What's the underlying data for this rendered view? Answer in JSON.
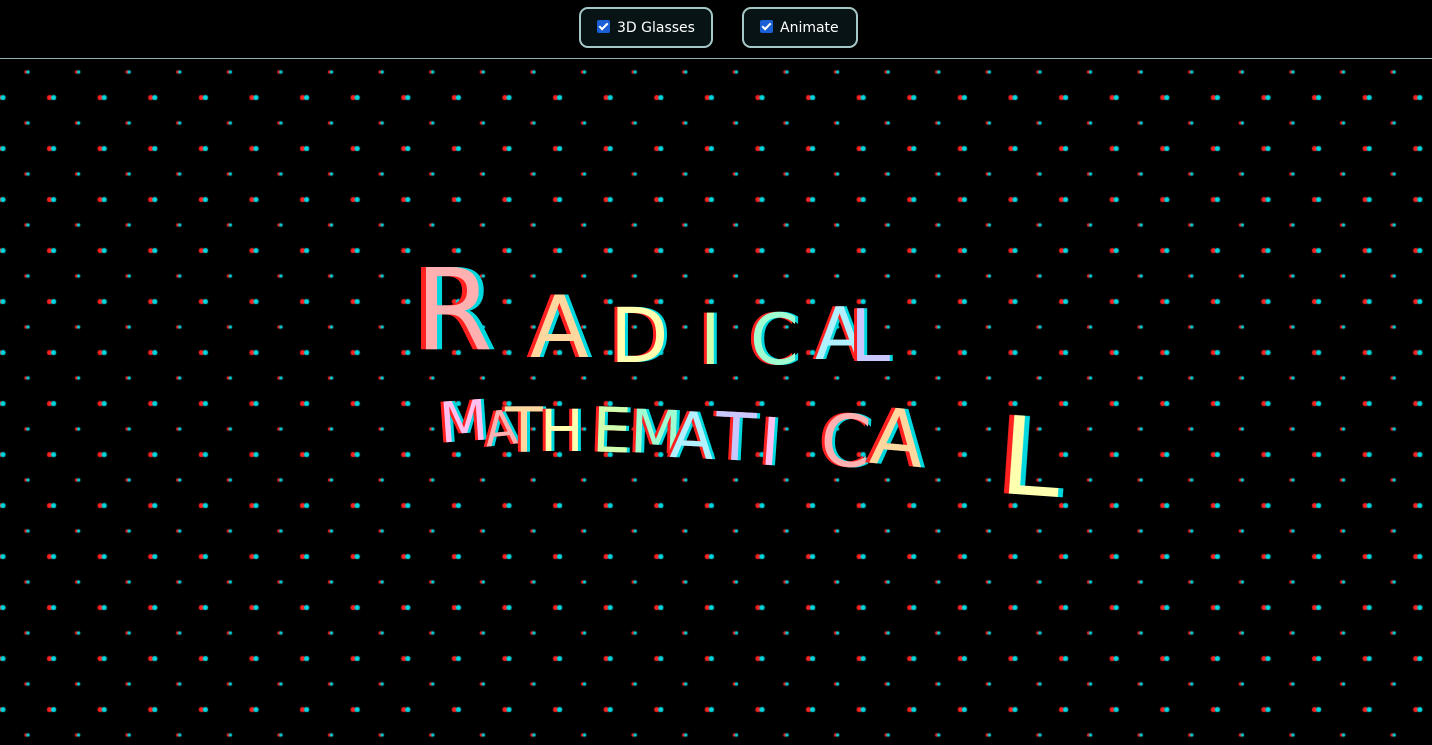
{
  "toolbar": {
    "glasses": {
      "label": "3D Glasses",
      "checked": true
    },
    "animate": {
      "label": "Animate",
      "checked": true
    }
  },
  "title_lines": [
    {
      "text": "RADICAL"
    },
    {
      "text": "MATHEMATICA"
    },
    {
      "text": "L"
    }
  ],
  "colors": {
    "background": "#000000",
    "left_eye": "#ff2020",
    "right_eye": "#00d8e0",
    "separator": "#8fb3b3",
    "letter_palette": [
      "#ffb0b0",
      "#ffd8a0",
      "#ffffb0",
      "#d0ffb0",
      "#a0ffd0",
      "#b0f0ff",
      "#c8c8ff",
      "#ffc0f0"
    ]
  }
}
